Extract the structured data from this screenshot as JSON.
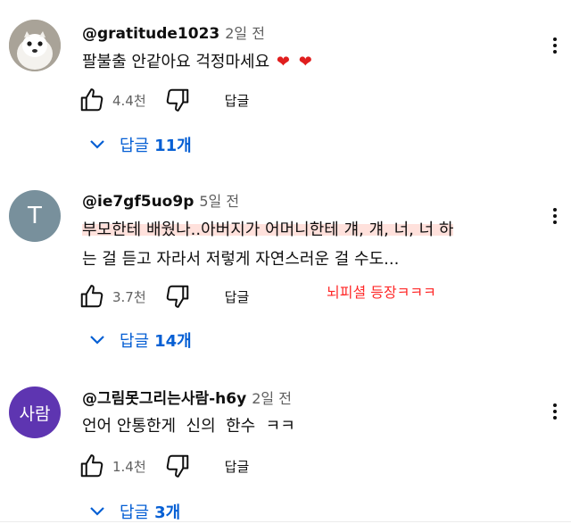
{
  "comments": [
    {
      "author": "@gratitude1023",
      "time": "2일 전",
      "lines": [
        "팔불출 안같아요 걱정마세요"
      ],
      "hearts": [
        "❤",
        "❤"
      ],
      "likes": "4.4천",
      "reply_label": "답글",
      "replies_label": "답글",
      "replies_count": "11개",
      "avatar": "ermine-photo"
    },
    {
      "author": "@ie7gf5uo9p",
      "time": "5일 전",
      "highlight_line": "부모한테 배웠나..아버지가 어머니한테 걔, 걔, 너, 너 하",
      "line2": "는 걸 듣고 자라서 저렇게 자연스러운 걸 수도...",
      "avatar_letter": "T",
      "likes": "3.7천",
      "reply_label": "답글",
      "replies_label": "답글",
      "replies_count": "14개"
    },
    {
      "author": "@그림못그리는사람-h6y",
      "time": "2일 전",
      "lines": [
        "언어 안통한게  신의  한수  ㅋㅋ"
      ],
      "avatar_text": "사람",
      "likes": "1.4천",
      "reply_label": "답글",
      "replies_label": "답글",
      "replies_count": "3개"
    }
  ],
  "annotation": "뇌피셜 등장ㅋㅋㅋ",
  "colors": {
    "link": "#065fd4",
    "annotation": "#ff2a2a",
    "heart": "#e01e1e",
    "highlight": "#ffe1dc"
  },
  "icons": [
    "thumb-up-icon",
    "thumb-down-icon",
    "chevron-down-icon",
    "more-vert-icon",
    "heart-icon"
  ]
}
